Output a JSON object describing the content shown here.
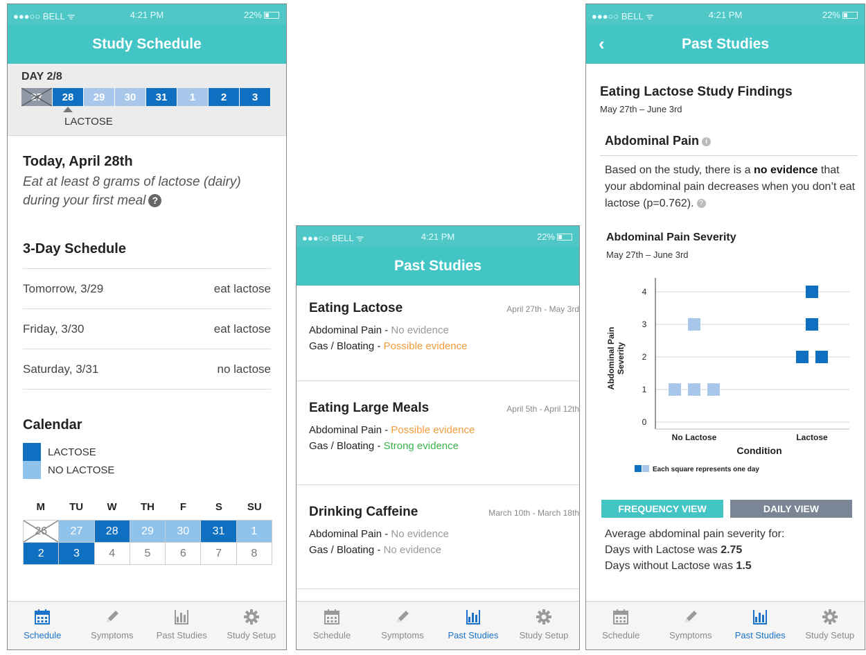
{
  "status": {
    "carrier": "●●●○○ BELL ᯤ",
    "time": "4:21 PM",
    "battery": "22%"
  },
  "colors": {
    "teal": "#43c5c5",
    "dark_blue": "#0f6fc0",
    "light_blue": "#8fc3ec",
    "orange": "#f39c3d",
    "green": "#3bb34a",
    "tab_active": "#1a73c9"
  },
  "tabs": [
    {
      "label": "Schedule",
      "icon": "calendar-icon"
    },
    {
      "label": "Symptoms",
      "icon": "pencil-icon"
    },
    {
      "label": "Past Studies",
      "icon": "bar-chart-icon"
    },
    {
      "label": "Study Setup",
      "icon": "gear-icon"
    }
  ],
  "schedule_screen": {
    "title": "Study Schedule",
    "day_label": "DAY 2/8",
    "day_strip": [
      {
        "label": "27",
        "type": "x"
      },
      {
        "label": "28",
        "type": "dark"
      },
      {
        "label": "29",
        "type": "light"
      },
      {
        "label": "30",
        "type": "light"
      },
      {
        "label": "31",
        "type": "dark"
      },
      {
        "label": "1",
        "type": "light"
      },
      {
        "label": "2",
        "type": "dark"
      },
      {
        "label": "3",
        "type": "dark"
      }
    ],
    "pointer_label": "LACTOSE",
    "today_title": "Today, April 28th",
    "today_instruction": "Eat at least 8 grams of lactose (dairy) during your first meal",
    "schedule_title": "3-Day Schedule",
    "schedule_rows": [
      {
        "day": "Tomorrow, 3/29",
        "action": "eat lactose"
      },
      {
        "day": "Friday, 3/30",
        "action": "eat lactose"
      },
      {
        "day": "Saturday, 3/31",
        "action": "no lactose"
      }
    ],
    "calendar_title": "Calendar",
    "legend": {
      "lactose": "LACTOSE",
      "no_lactose": "NO LACTOSE"
    },
    "weekdays": [
      "M",
      "TU",
      "W",
      "TH",
      "F",
      "S",
      "SU"
    ],
    "calendar_days": [
      {
        "label": "26",
        "type": "cross"
      },
      {
        "label": "27",
        "type": "light"
      },
      {
        "label": "28",
        "type": "dark"
      },
      {
        "label": "29",
        "type": "light"
      },
      {
        "label": "30",
        "type": "light"
      },
      {
        "label": "31",
        "type": "dark"
      },
      {
        "label": "1",
        "type": "light"
      },
      {
        "label": "2",
        "type": "dark"
      },
      {
        "label": "3",
        "type": "dark"
      },
      {
        "label": "4",
        "type": "empty"
      },
      {
        "label": "5",
        "type": "empty"
      },
      {
        "label": "6",
        "type": "empty"
      },
      {
        "label": "7",
        "type": "empty"
      },
      {
        "label": "8",
        "type": "empty"
      }
    ]
  },
  "past_studies_screen": {
    "title": "Past Studies",
    "studies": [
      {
        "name": "Eating Lactose",
        "dates": "April 27th - May 3rd",
        "rows": [
          {
            "symptom": "Abdominal Pain -",
            "evidence": "No evidence",
            "level": "none"
          },
          {
            "symptom": "Gas / Bloating  -",
            "evidence": "Possible evidence",
            "level": "possible"
          }
        ]
      },
      {
        "name": "Eating Large Meals",
        "dates": "April 5th - April 12th",
        "rows": [
          {
            "symptom": "Abdominal Pain -",
            "evidence": "Possible evidence",
            "level": "possible"
          },
          {
            "symptom": "Gas / Bloating  -",
            "evidence": "Strong evidence",
            "level": "strong"
          }
        ]
      },
      {
        "name": "Drinking Caffeine",
        "dates": "March 10th - March 18th",
        "rows": [
          {
            "symptom": "Abdominal Pain -",
            "evidence": "No evidence",
            "level": "none"
          },
          {
            "symptom": "Gas / Bloating  -",
            "evidence": "No evidence",
            "level": "none"
          }
        ]
      }
    ]
  },
  "findings_screen": {
    "title": "Past Studies",
    "back": "‹",
    "findings_title": "Eating Lactose Study Findings",
    "findings_dates": "May 27th – June 3rd",
    "section_title": "Abdominal Pain",
    "summary_pre": "Based on the study, there is a ",
    "summary_bold": "no evidence",
    "summary_post": " that your abdominal pain decreases when you don’t eat lactose (p=0.762).",
    "chart_title": "Abdominal Pain Severity",
    "chart_dates": "May 27th – June 3rd",
    "frequency_view": "FREQUENCY VIEW",
    "daily_view": "DAILY VIEW",
    "avg_intro": "Average abdominal pain severity for:",
    "avg_with_label": "Days with Lactose was ",
    "avg_with_value": "2.75",
    "avg_without_label": "Days without Lactose was ",
    "avg_without_value": "1.5"
  },
  "chart_data": {
    "type": "scatter",
    "title": "",
    "xlabel": "Condition",
    "ylabel": "Abdominal Pain Severity",
    "categories": [
      "No Lactose",
      "Lactose"
    ],
    "ylim": [
      0,
      4
    ],
    "yticks": [
      "0",
      "1",
      "2",
      "3",
      "4"
    ],
    "grid": true,
    "legend_note": "Each square represents one day",
    "series": [
      {
        "name": "No Lactose",
        "color": "#a8c7ea",
        "values": [
          1,
          1,
          1,
          3
        ]
      },
      {
        "name": "Lactose",
        "color": "#0f6fc0",
        "values": [
          2,
          2,
          3,
          4
        ]
      }
    ]
  }
}
